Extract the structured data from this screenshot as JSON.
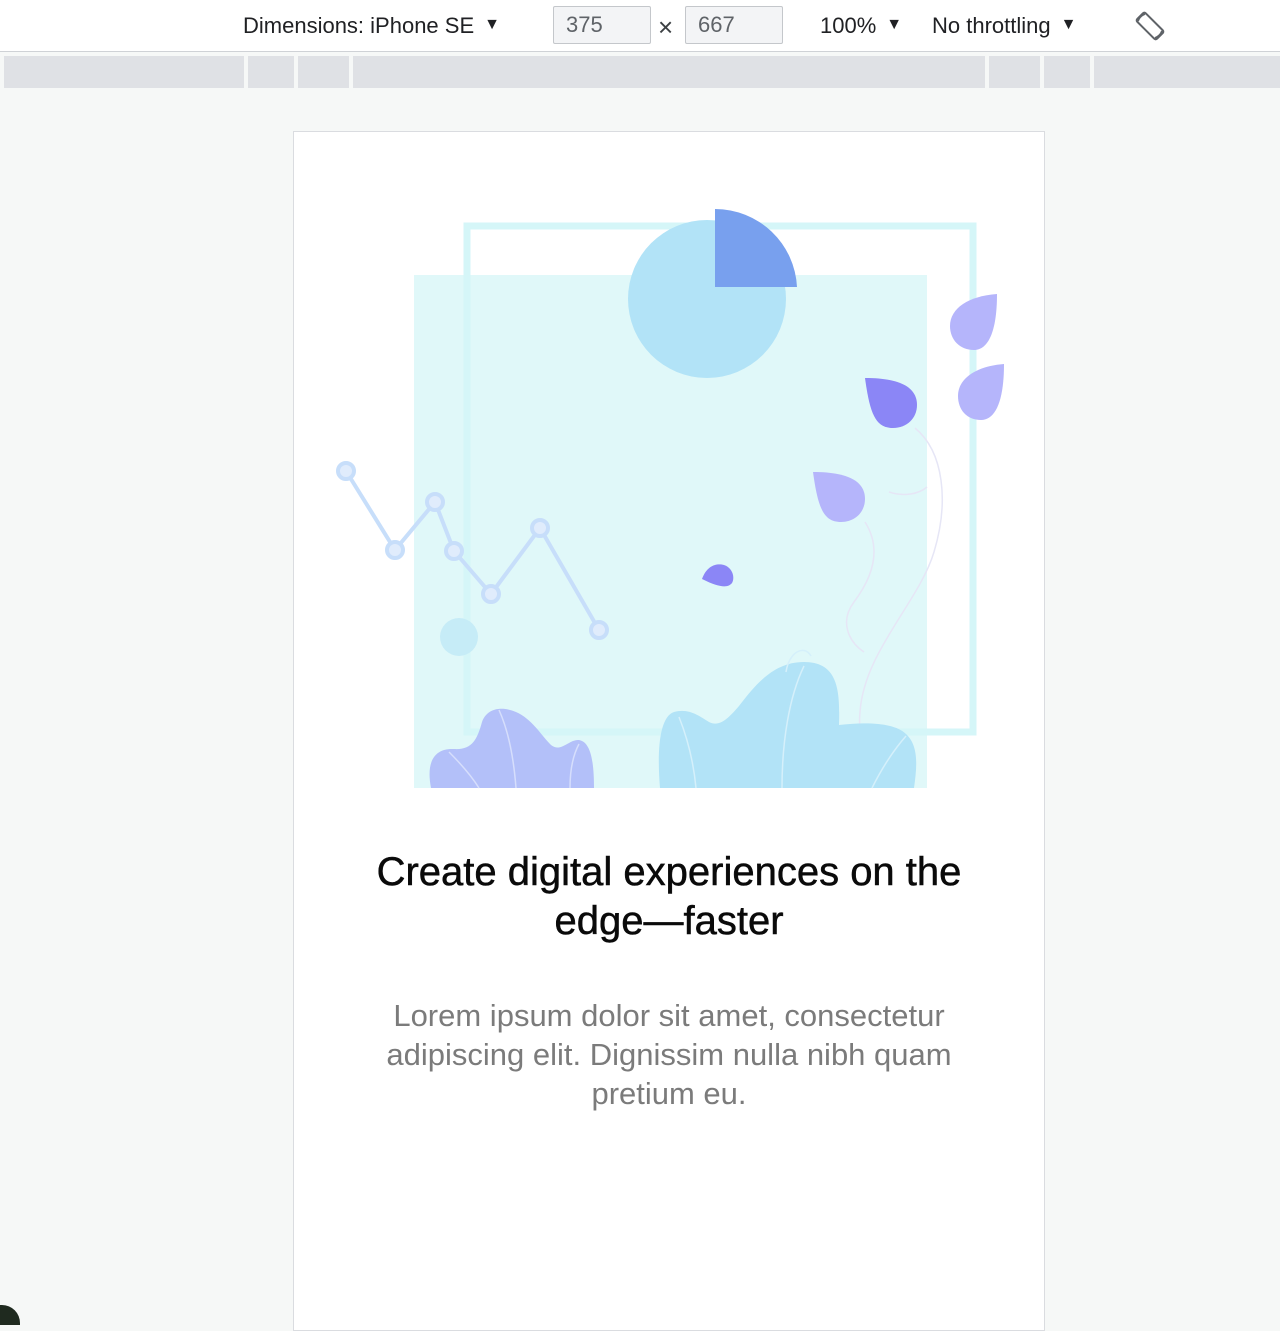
{
  "toolbar": {
    "dimensions_label": "Dimensions: iPhone SE",
    "width_value": "375",
    "times_symbol": "×",
    "height_value": "667",
    "zoom_label": "100%",
    "throttling_label": "No throttling",
    "caret_symbol": "▼",
    "rotate_icon": "rotate-icon"
  },
  "page": {
    "headline": "Create digital experiences on the edge—faster",
    "body": "Lorem ipsum dolor sit amet, consectetur adipiscing elit. Dignissim nulla nibh quam pretium eu."
  },
  "colors": {
    "light_cyan": "#e0f8f9",
    "frame_cyan": "#d5f6f8",
    "sky_blue": "#b2e3f7",
    "pie_blue": "#78a0ee",
    "lavender": "#b5b5fb",
    "violet": "#8b86f6",
    "periwinkle": "#b3c0f9",
    "chart_line": "#c7defa",
    "text_dark": "#0a0a0a",
    "text_muted": "#7b7b7b"
  }
}
